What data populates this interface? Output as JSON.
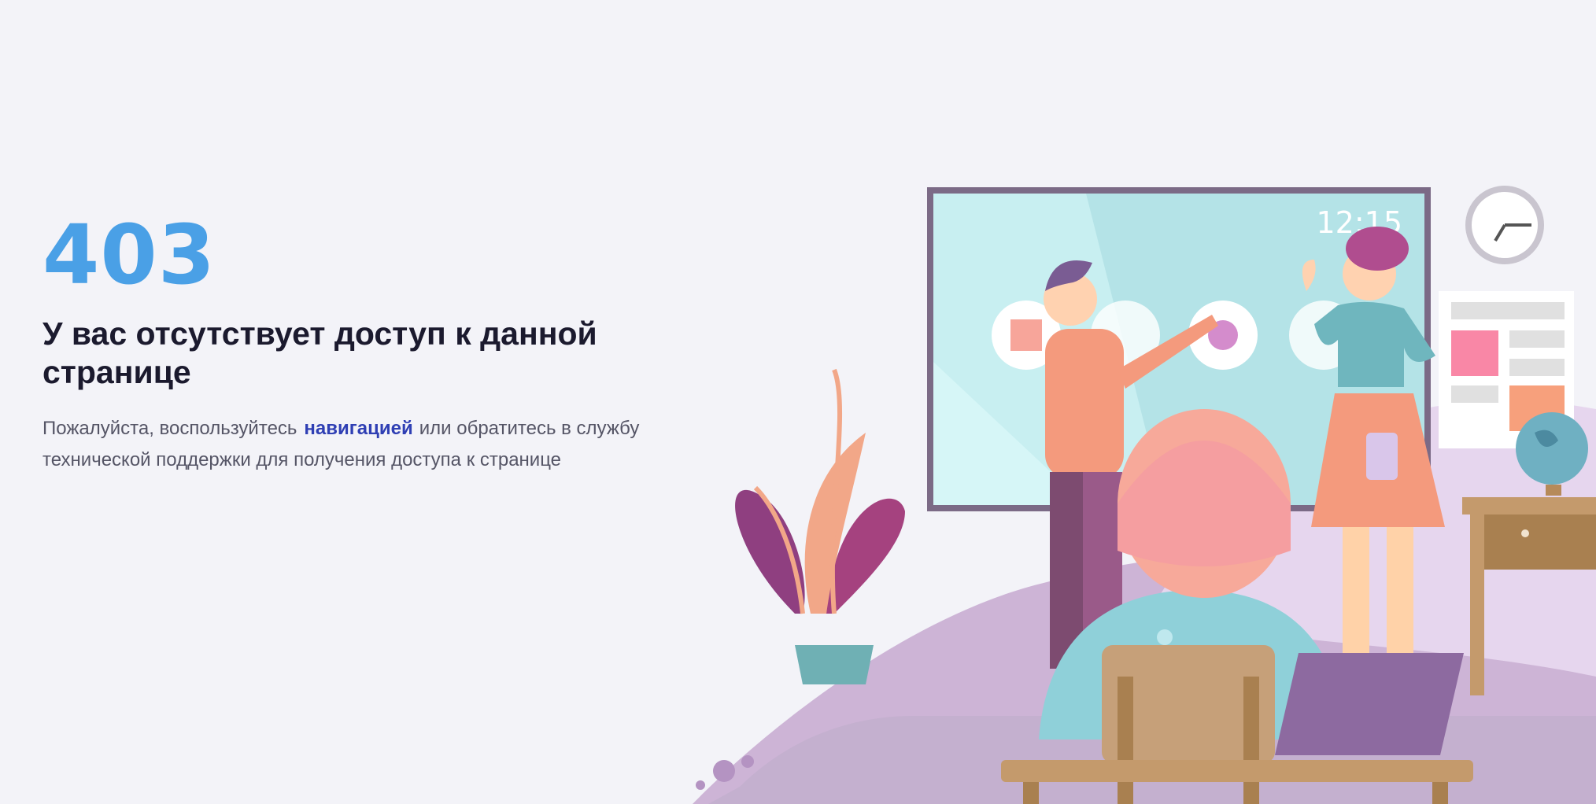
{
  "error": {
    "code": "403",
    "title": "У вас отсутствует доступ к данной странице",
    "message_before": "Пожалуйста, воспользуйтесь",
    "link_label": "навигацией",
    "message_after": "или обратитесь в службу технической поддержки для получения доступа к странице"
  },
  "illustration": {
    "screen_time": "12:15",
    "icons": [
      "classroom-illustration",
      "screen-icon",
      "clock-icon",
      "globe-icon",
      "plant-icon",
      "laptop-icon",
      "chair-icon"
    ]
  },
  "colors": {
    "code": "#4aa0e6",
    "title": "#1b1a2e",
    "text": "#555566",
    "link": "#2f3fb4",
    "background": "#f3f3f8"
  }
}
